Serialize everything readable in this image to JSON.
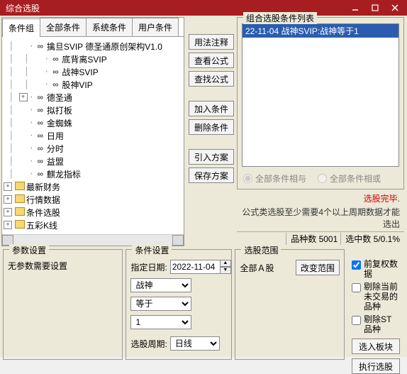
{
  "window": {
    "title": "综合选股"
  },
  "tabs": [
    "条件组",
    "全部条件",
    "系统条件",
    "用户条件"
  ],
  "tree": {
    "root_items": [
      {
        "label": "擒旦SVIP 德圣通原创架构V1.0",
        "indent": 1,
        "icon": "link",
        "exp": ""
      },
      {
        "label": "底背离SVIP",
        "indent": 2,
        "icon": "link",
        "exp": ""
      },
      {
        "label": "战神SVIP",
        "indent": 2,
        "icon": "link",
        "exp": ""
      },
      {
        "label": "股神VIP",
        "indent": 2,
        "icon": "link",
        "exp": ""
      },
      {
        "label": "德圣通",
        "indent": 1,
        "icon": "link",
        "exp": "+"
      },
      {
        "label": "拟打板",
        "indent": 1,
        "icon": "link",
        "exp": ""
      },
      {
        "label": "金蜘蛛",
        "indent": 1,
        "icon": "link",
        "exp": ""
      },
      {
        "label": "日用",
        "indent": 1,
        "icon": "link",
        "exp": ""
      },
      {
        "label": "分时",
        "indent": 1,
        "icon": "link",
        "exp": ""
      },
      {
        "label": "益盟",
        "indent": 1,
        "icon": "link",
        "exp": ""
      },
      {
        "label": "麒龙指标",
        "indent": 1,
        "icon": "link",
        "exp": ""
      }
    ],
    "folders": [
      {
        "label": "最新财务",
        "exp": "+"
      },
      {
        "label": "行情数据",
        "exp": "+"
      },
      {
        "label": "条件选股",
        "exp": "+"
      },
      {
        "label": "五彩K线",
        "exp": "+"
      }
    ]
  },
  "mid_buttons": {
    "usage": "用法注释",
    "view": "查看公式",
    "find": "查找公式",
    "add": "加入条件",
    "del": "删除条件",
    "import": "引入方案",
    "save": "保存方案"
  },
  "combo_list": {
    "legend": "组合选股条件列表",
    "items": [
      "22-11-04 战神SVIP:战神等于1"
    ],
    "radio_and": "全部条件相与",
    "radio_or": "全部条件相或"
  },
  "status": {
    "done": "选股完毕.",
    "note": "公式类选股至少需要4个以上周期数据才能选出",
    "count_label": "品种数",
    "count_val": "5001",
    "hit_label": "选中数",
    "hit_val": "5/0.1%"
  },
  "params": {
    "legend": "参数设置",
    "empty": "无参数需要设置"
  },
  "cond": {
    "legend": "条件设置",
    "date_label": "指定日期:",
    "date_val": "2022-11-04",
    "sel1": "战神",
    "sel2": "等于",
    "sel3": "1",
    "period_label": "选股周期:",
    "period_val": "日线"
  },
  "scope": {
    "legend": "选股范围",
    "label": "全部Ａ股",
    "change_btn": "改变范围"
  },
  "opts": {
    "cb1": "前复权数据",
    "cb2": "剔除当前未交易的品种",
    "cb3": "剔除ST品种",
    "btn_board": "选入板块",
    "btn_exec": "执行选股"
  }
}
